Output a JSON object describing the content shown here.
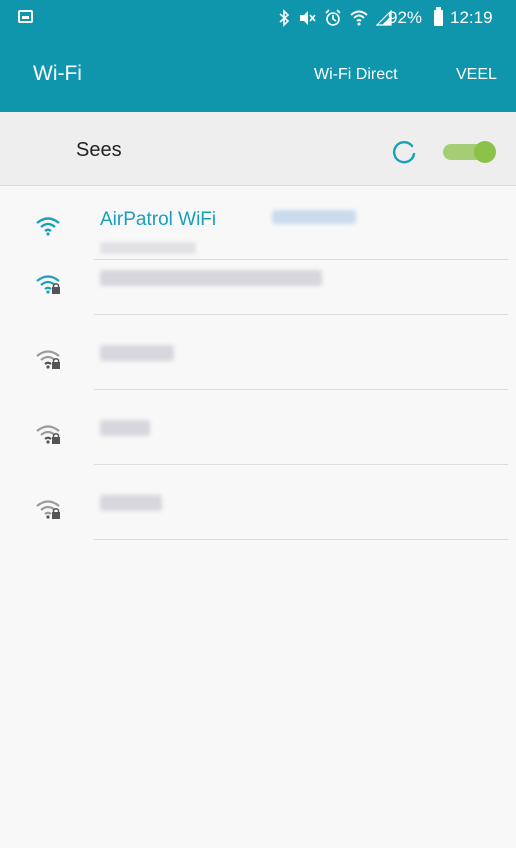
{
  "status_bar": {
    "battery": "92%",
    "time": "12:19",
    "icons": [
      "screenshot-icon",
      "bluetooth-icon",
      "mute-icon",
      "alarm-icon",
      "wifi-status-icon",
      "signal-icon",
      "battery-icon"
    ]
  },
  "app_bar": {
    "title": "Wi-Fi",
    "wifi_direct": "Wi-Fi Direct",
    "more": "VEEL"
  },
  "wifi_switch": {
    "label": "Sees",
    "state": "on",
    "scanning": true
  },
  "networks": [
    {
      "name": "AirPatrol WiFi",
      "connected": true,
      "secured": false,
      "signal": "full"
    },
    {
      "name": "",
      "connected": false,
      "secured": true,
      "signal": "full"
    },
    {
      "name": "",
      "connected": false,
      "secured": true,
      "signal": "weak"
    },
    {
      "name": "",
      "connected": false,
      "secured": true,
      "signal": "weak"
    },
    {
      "name": "",
      "connected": false,
      "secured": true,
      "signal": "weak"
    }
  ],
  "colors": {
    "primary": "#0f96ad",
    "accent": "#1a9fb8",
    "toggle_on": "#8bc34a"
  }
}
